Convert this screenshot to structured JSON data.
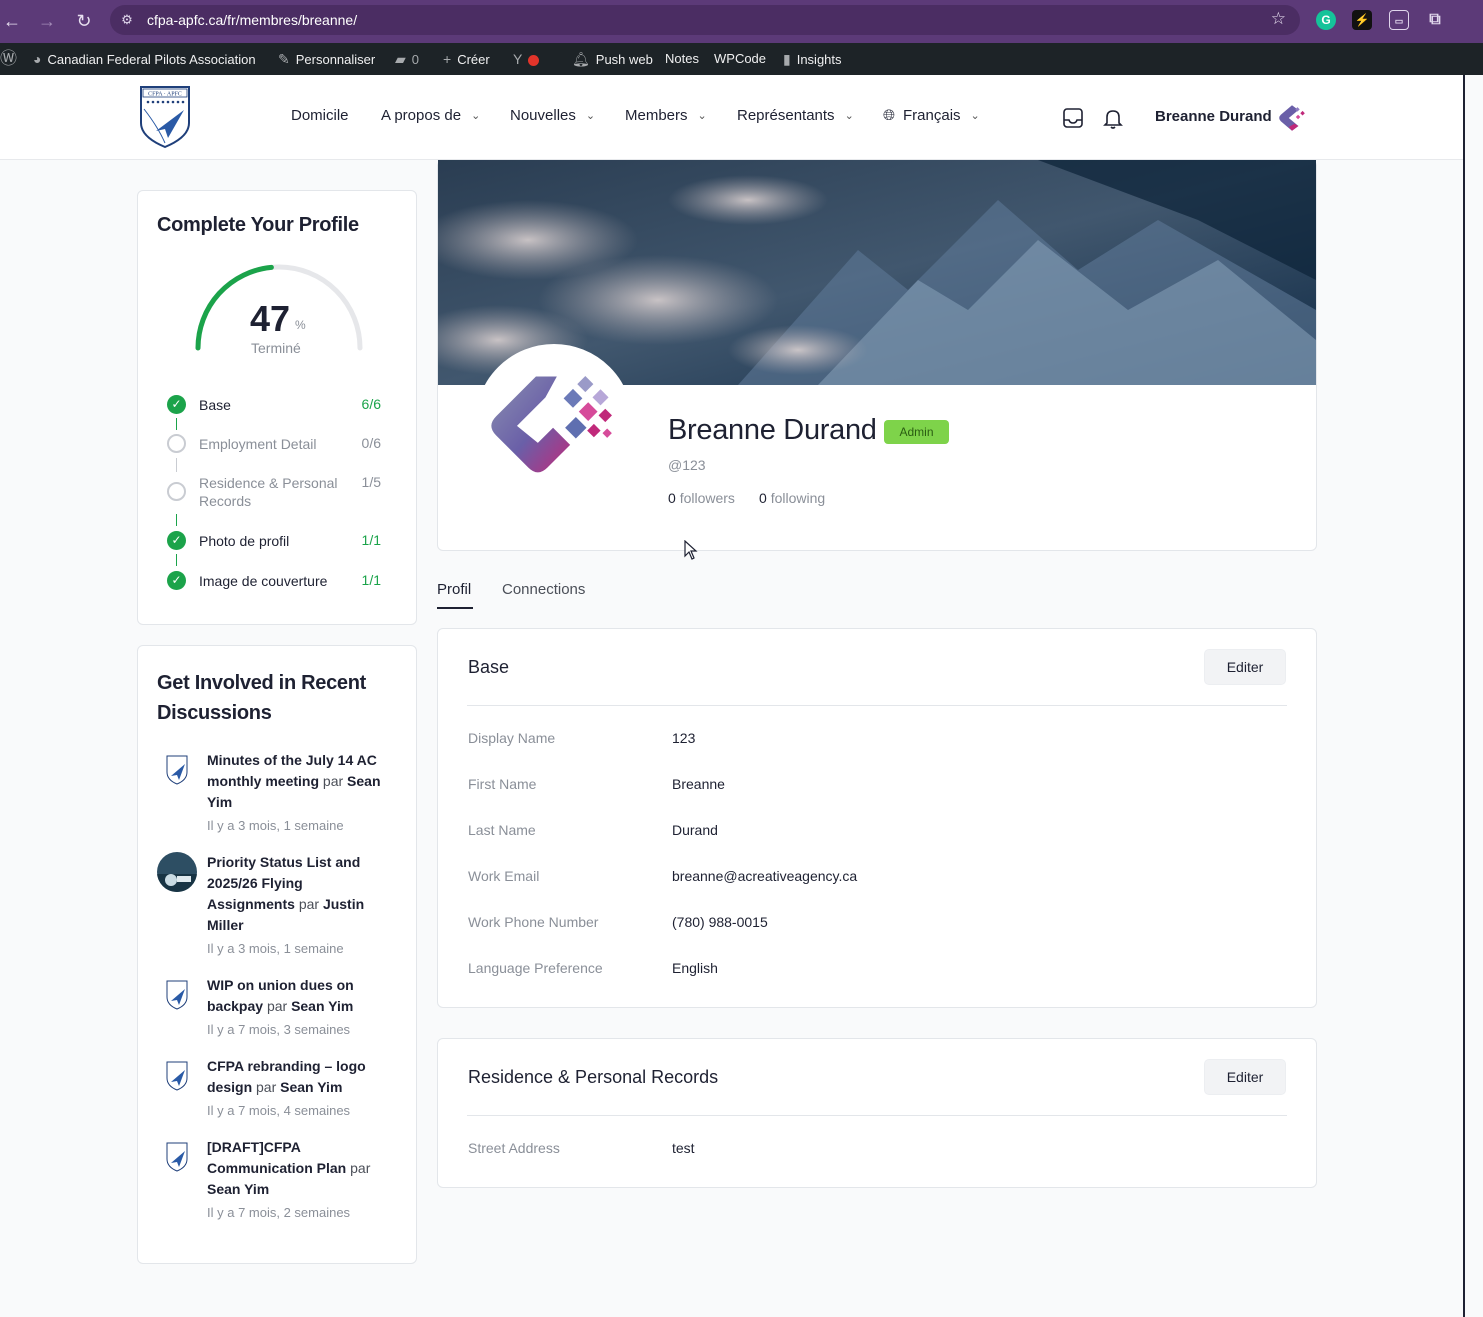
{
  "browser": {
    "url": "cfpa-apfc.ca/fr/membres/breanne/"
  },
  "wp_admin_bar": {
    "site_name": "Canadian Federal Pilots Association",
    "customize": "Personnaliser",
    "comments_count": "0",
    "new": "Créer",
    "push": "Push web",
    "notes": "Notes",
    "wpcode": "WPCode",
    "insights": "Insights"
  },
  "header": {
    "nav": [
      "Domicile",
      "A propos de",
      "Nouvelles",
      "Members",
      "Représentants",
      "Français"
    ],
    "user_name": "Breanne Durand"
  },
  "complete_profile": {
    "title": "Complete Your Profile",
    "percent": "47",
    "percent_sign": "%",
    "status": "Terminé",
    "steps": [
      {
        "label": "Base",
        "count": "6/6",
        "done": true
      },
      {
        "label": "Employment Detail",
        "count": "0/6",
        "done": false
      },
      {
        "label": "Residence & Personal Records",
        "count": "1/5",
        "done": false
      },
      {
        "label": "Photo de profil",
        "count": "1/1",
        "done": true
      },
      {
        "label": "Image de couverture",
        "count": "1/1",
        "done": true
      }
    ]
  },
  "discussions": {
    "title": "Get Involved in Recent Discussions",
    "par": "par",
    "items": [
      {
        "title": "Minutes of the July 14 AC monthly meeting",
        "author": "Sean Yim",
        "time": "Il y a 3 mois, 1 semaine"
      },
      {
        "title": "Priority Status List and 2025/26 Flying Assignments",
        "author": "Justin Miller",
        "time": "Il y a 3 mois, 1 semaine"
      },
      {
        "title": "WIP on union dues on backpay",
        "author": "Sean Yim",
        "time": "Il y a 7 mois, 3 semaines"
      },
      {
        "title": "CFPA rebranding – logo design",
        "author": "Sean Yim",
        "time": "Il y a 7 mois, 4 semaines"
      },
      {
        "title": "[DRAFT]CFPA Communication Plan",
        "author": "Sean Yim",
        "time": "Il y a 7 mois, 2 semaines"
      }
    ]
  },
  "profile": {
    "name": "Breanne Durand",
    "badge": "Admin",
    "handle": "@123",
    "followers_count": "0",
    "followers_label": "followers",
    "following_count": "0",
    "following_label": "following"
  },
  "tabs": [
    "Profil",
    "Connections"
  ],
  "base_section": {
    "title": "Base",
    "edit": "Editer",
    "fields": [
      {
        "label": "Display Name",
        "value": "123"
      },
      {
        "label": "First Name",
        "value": "Breanne"
      },
      {
        "label": "Last Name",
        "value": "Durand"
      },
      {
        "label": "Work Email",
        "value": "breanne@acreativeagency.ca"
      },
      {
        "label": "Work Phone Number",
        "value": "(780) 988-0015"
      },
      {
        "label": "Language Preference",
        "value": "English"
      }
    ]
  },
  "residence_section": {
    "title": "Residence & Personal Records",
    "edit": "Editer",
    "fields": [
      {
        "label": "Street Address",
        "value": "test"
      }
    ]
  },
  "colors": {
    "browser": "#5c3a78",
    "wp_bar": "#1d2327",
    "success": "#1ba34a",
    "admin_badge": "#7ed34a"
  }
}
